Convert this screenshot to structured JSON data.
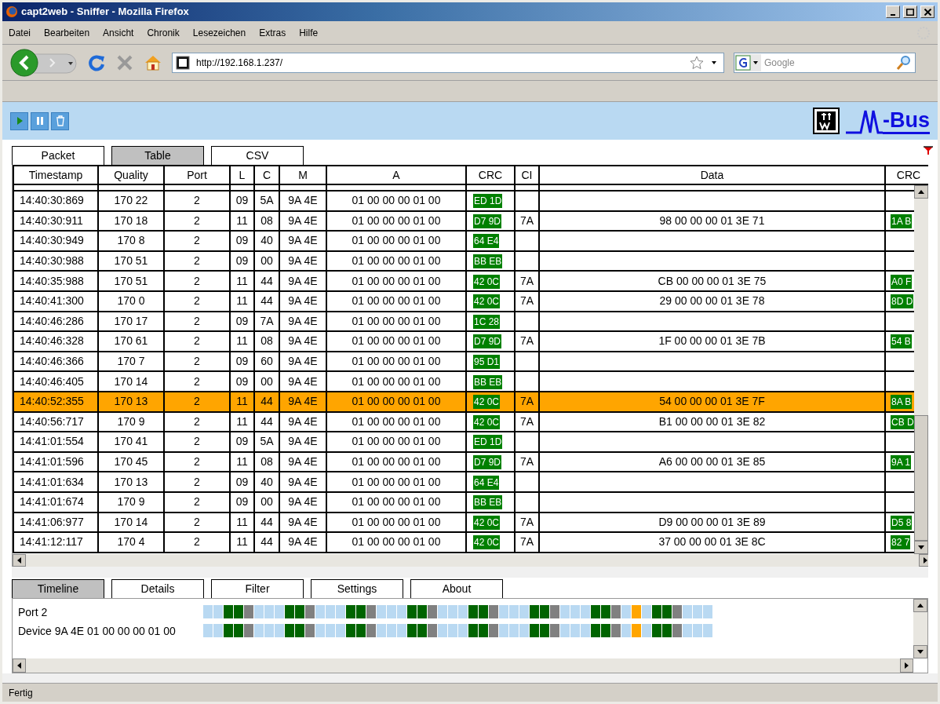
{
  "window": {
    "title": "capt2web - Sniffer - Mozilla Firefox"
  },
  "menu": [
    "Datei",
    "Bearbeiten",
    "Ansicht",
    "Chronik",
    "Lesezeichen",
    "Extras",
    "Hilfe"
  ],
  "address_bar": {
    "value": "http://192.168.1.237/"
  },
  "search": {
    "placeholder": "Google"
  },
  "logo": {
    "text": "-Bus"
  },
  "view_tabs": [
    {
      "label": "Packet",
      "selected": false
    },
    {
      "label": "Table",
      "selected": true
    },
    {
      "label": "CSV",
      "selected": false
    }
  ],
  "table": {
    "columns": [
      {
        "label": "Timestamp",
        "kind": "text"
      },
      {
        "label": "Quality",
        "kind": "text"
      },
      {
        "label": "Port",
        "kind": "text"
      },
      {
        "label": "L",
        "kind": "text"
      },
      {
        "label": "C",
        "kind": "text"
      },
      {
        "label": "M",
        "kind": "text"
      },
      {
        "label": "A",
        "kind": "text"
      },
      {
        "label": "CRC",
        "kind": "crc"
      },
      {
        "label": "CI",
        "kind": "text"
      },
      {
        "label": "Data",
        "kind": "text"
      },
      {
        "label": "CRC",
        "kind": "crc"
      }
    ],
    "rows": [
      {
        "selected": false,
        "cells": [
          "14:40:30:869",
          "170 22",
          "2",
          "09",
          "5A",
          "9A 4E",
          "01 00 00 00 01 00",
          "ED 1D",
          null,
          null,
          null
        ]
      },
      {
        "selected": false,
        "cells": [
          "14:40:30:911",
          "170 18",
          "2",
          "11",
          "08",
          "9A 4E",
          "01 00 00 00 01 00",
          "D7 9D",
          "7A",
          "98 00 00 00 01 3E 71",
          "1A B"
        ]
      },
      {
        "selected": false,
        "cells": [
          "14:40:30:949",
          "170 8",
          "2",
          "09",
          "40",
          "9A 4E",
          "01 00 00 00 01 00",
          "64 E4",
          null,
          null,
          null
        ]
      },
      {
        "selected": false,
        "cells": [
          "14:40:30:988",
          "170 51",
          "2",
          "09",
          "00",
          "9A 4E",
          "01 00 00 00 01 00",
          "BB EB",
          null,
          null,
          null
        ]
      },
      {
        "selected": false,
        "cells": [
          "14:40:35:988",
          "170 51",
          "2",
          "11",
          "44",
          "9A 4E",
          "01 00 00 00 01 00",
          "42 0C",
          "7A",
          "CB 00 00 00 01 3E 75",
          "A0 F"
        ]
      },
      {
        "selected": false,
        "cells": [
          "14:40:41:300",
          "170 0",
          "2",
          "11",
          "44",
          "9A 4E",
          "01 00 00 00 01 00",
          "42 0C",
          "7A",
          "29 00 00 00 01 3E 78",
          "8D D"
        ]
      },
      {
        "selected": false,
        "cells": [
          "14:40:46:286",
          "170 17",
          "2",
          "09",
          "7A",
          "9A 4E",
          "01 00 00 00 01 00",
          "1C 28",
          null,
          null,
          null
        ]
      },
      {
        "selected": false,
        "cells": [
          "14:40:46:328",
          "170 61",
          "2",
          "11",
          "08",
          "9A 4E",
          "01 00 00 00 01 00",
          "D7 9D",
          "7A",
          "1F 00 00 00 01 3E 7B",
          "54 B"
        ]
      },
      {
        "selected": false,
        "cells": [
          "14:40:46:366",
          "170 7",
          "2",
          "09",
          "60",
          "9A 4E",
          "01 00 00 00 01 00",
          "95 D1",
          null,
          null,
          null
        ]
      },
      {
        "selected": false,
        "cells": [
          "14:40:46:405",
          "170 14",
          "2",
          "09",
          "00",
          "9A 4E",
          "01 00 00 00 01 00",
          "BB EB",
          null,
          null,
          null
        ]
      },
      {
        "selected": true,
        "cells": [
          "14:40:52:355",
          "170 13",
          "2",
          "11",
          "44",
          "9A 4E",
          "01 00 00 00 01 00",
          "42 0C",
          "7A",
          "54 00 00 00 01 3E 7F",
          "8A B"
        ]
      },
      {
        "selected": false,
        "cells": [
          "14:40:56:717",
          "170 9",
          "2",
          "11",
          "44",
          "9A 4E",
          "01 00 00 00 01 00",
          "42 0C",
          "7A",
          "B1 00 00 00 01 3E 82",
          "CB D"
        ]
      },
      {
        "selected": false,
        "cells": [
          "14:41:01:554",
          "170 41",
          "2",
          "09",
          "5A",
          "9A 4E",
          "01 00 00 00 01 00",
          "ED 1D",
          null,
          null,
          null
        ]
      },
      {
        "selected": false,
        "cells": [
          "14:41:01:596",
          "170 45",
          "2",
          "11",
          "08",
          "9A 4E",
          "01 00 00 00 01 00",
          "D7 9D",
          "7A",
          "A6 00 00 00 01 3E 85",
          "9A 1"
        ]
      },
      {
        "selected": false,
        "cells": [
          "14:41:01:634",
          "170 13",
          "2",
          "09",
          "40",
          "9A 4E",
          "01 00 00 00 01 00",
          "64 E4",
          null,
          null,
          null
        ]
      },
      {
        "selected": false,
        "cells": [
          "14:41:01:674",
          "170 9",
          "2",
          "09",
          "00",
          "9A 4E",
          "01 00 00 00 01 00",
          "BB EB",
          null,
          null,
          null
        ]
      },
      {
        "selected": false,
        "cells": [
          "14:41:06:977",
          "170 14",
          "2",
          "11",
          "44",
          "9A 4E",
          "01 00 00 00 01 00",
          "42 0C",
          "7A",
          "D9 00 00 00 01 3E 89",
          "D5 8"
        ]
      },
      {
        "selected": false,
        "cells": [
          "14:41:12:117",
          "170 4",
          "2",
          "11",
          "44",
          "9A 4E",
          "01 00 00 00 01 00",
          "42 0C",
          "7A",
          "37 00 00 00 01 3E 8C",
          "82 7"
        ]
      }
    ]
  },
  "panel_tabs": [
    {
      "label": "Timeline",
      "selected": true
    },
    {
      "label": "Details",
      "selected": false
    },
    {
      "label": "Filter",
      "selected": false
    },
    {
      "label": "Settings",
      "selected": false
    },
    {
      "label": "About",
      "selected": false
    }
  ],
  "timeline": [
    {
      "label": "Port 2",
      "cells": [
        {
          "color": "#b9d9f2"
        },
        {
          "color": "#b9d9f2"
        },
        {
          "color": "#006400"
        },
        {
          "color": "#006400"
        },
        {
          "color": "#808080"
        },
        {
          "color": "#b9d9f2"
        },
        {
          "color": "#b9d9f2"
        },
        {
          "color": "#b9d9f2"
        },
        {
          "color": "#006400"
        },
        {
          "color": "#006400"
        },
        {
          "color": "#808080"
        },
        {
          "color": "#b9d9f2"
        },
        {
          "color": "#b9d9f2"
        },
        {
          "color": "#b9d9f2"
        },
        {
          "color": "#006400"
        },
        {
          "color": "#006400"
        },
        {
          "color": "#808080"
        },
        {
          "color": "#b9d9f2"
        },
        {
          "color": "#b9d9f2"
        },
        {
          "color": "#b9d9f2"
        },
        {
          "color": "#006400"
        },
        {
          "color": "#006400"
        },
        {
          "color": "#808080"
        },
        {
          "color": "#b9d9f2"
        },
        {
          "color": "#b9d9f2"
        },
        {
          "color": "#b9d9f2"
        },
        {
          "color": "#006400"
        },
        {
          "color": "#006400"
        },
        {
          "color": "#808080"
        },
        {
          "color": "#b9d9f2"
        },
        {
          "color": "#b9d9f2"
        },
        {
          "color": "#b9d9f2"
        },
        {
          "color": "#006400"
        },
        {
          "color": "#006400"
        },
        {
          "color": "#808080"
        },
        {
          "color": "#b9d9f2"
        },
        {
          "color": "#b9d9f2"
        },
        {
          "color": "#b9d9f2"
        },
        {
          "color": "#006400"
        },
        {
          "color": "#006400"
        },
        {
          "color": "#808080"
        },
        {
          "color": "#b9d9f2"
        },
        {
          "color": "#ffa500"
        },
        {
          "color": "#b9d9f2"
        },
        {
          "color": "#006400"
        },
        {
          "color": "#006400"
        },
        {
          "color": "#808080"
        },
        {
          "color": "#b9d9f2"
        },
        {
          "color": "#b9d9f2"
        },
        {
          "color": "#b9d9f2"
        }
      ]
    },
    {
      "label": "Device 9A 4E 01 00 00 00 01 00",
      "cells": [
        {
          "color": "#b9d9f2"
        },
        {
          "color": "#b9d9f2"
        },
        {
          "color": "#006400"
        },
        {
          "color": "#006400"
        },
        {
          "color": "#808080"
        },
        {
          "color": "#b9d9f2"
        },
        {
          "color": "#b9d9f2"
        },
        {
          "color": "#b9d9f2"
        },
        {
          "color": "#006400"
        },
        {
          "color": "#006400"
        },
        {
          "color": "#808080"
        },
        {
          "color": "#b9d9f2"
        },
        {
          "color": "#b9d9f2"
        },
        {
          "color": "#b9d9f2"
        },
        {
          "color": "#006400"
        },
        {
          "color": "#006400"
        },
        {
          "color": "#808080"
        },
        {
          "color": "#b9d9f2"
        },
        {
          "color": "#b9d9f2"
        },
        {
          "color": "#b9d9f2"
        },
        {
          "color": "#006400"
        },
        {
          "color": "#006400"
        },
        {
          "color": "#808080"
        },
        {
          "color": "#b9d9f2"
        },
        {
          "color": "#b9d9f2"
        },
        {
          "color": "#b9d9f2"
        },
        {
          "color": "#006400"
        },
        {
          "color": "#006400"
        },
        {
          "color": "#808080"
        },
        {
          "color": "#b9d9f2"
        },
        {
          "color": "#b9d9f2"
        },
        {
          "color": "#b9d9f2"
        },
        {
          "color": "#006400"
        },
        {
          "color": "#006400"
        },
        {
          "color": "#808080"
        },
        {
          "color": "#b9d9f2"
        },
        {
          "color": "#b9d9f2"
        },
        {
          "color": "#b9d9f2"
        },
        {
          "color": "#006400"
        },
        {
          "color": "#006400"
        },
        {
          "color": "#808080"
        },
        {
          "color": "#b9d9f2"
        },
        {
          "color": "#ffa500"
        },
        {
          "color": "#b9d9f2"
        },
        {
          "color": "#006400"
        },
        {
          "color": "#006400"
        },
        {
          "color": "#808080"
        },
        {
          "color": "#b9d9f2"
        },
        {
          "color": "#b9d9f2"
        },
        {
          "color": "#b9d9f2"
        }
      ]
    }
  ],
  "status_bar": {
    "text": "Fertig"
  }
}
